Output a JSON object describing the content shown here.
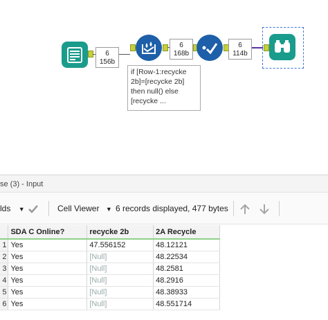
{
  "workflow": {
    "links": [
      {
        "count": "6",
        "size": "156b"
      },
      {
        "count": "6",
        "size": "168b"
      },
      {
        "count": "6",
        "size": "114b"
      }
    ],
    "annotation": [
      "if [Row-1:recycke",
      "2b]=[recycke 2b]",
      "then null() else",
      "[recycke ..."
    ]
  },
  "panel": {
    "title": "se (3) - Input"
  },
  "toolbar": {
    "fields_label": "lds",
    "cell_viewer_label": "Cell Viewer",
    "records_text": "6 records displayed, 477 bytes"
  },
  "grid": {
    "columns": [
      "SDA C Online?",
      "recycke 2b",
      "2A Recycle"
    ],
    "rows": [
      {
        "num": "1",
        "c1": "Yes",
        "c2": "47.556152",
        "c3": "48.12121"
      },
      {
        "num": "2",
        "c1": "Yes",
        "c2": "[Null]",
        "c3": "48.22534"
      },
      {
        "num": "3",
        "c1": "Yes",
        "c2": "[Null]",
        "c3": "48.2581"
      },
      {
        "num": "4",
        "c1": "Yes",
        "c2": "[Null]",
        "c3": "48.2916"
      },
      {
        "num": "5",
        "c1": "Yes",
        "c2": "[Null]",
        "c3": "48.38933"
      },
      {
        "num": "6",
        "c1": "Yes",
        "c2": "[Null]",
        "c3": "48.551714"
      }
    ]
  },
  "icons": {
    "input": "book-icon",
    "multirow": "multi-row-formula-icon",
    "select": "select-check-icon",
    "browse": "binoculars-icon"
  },
  "colors": {
    "input_tool": "#1a9c8c",
    "prep_tool": "#1d5fa8",
    "browse_tool": "#1a9c8c",
    "anchor": "#c7cf3d",
    "header_underline": "#8fd08a"
  }
}
